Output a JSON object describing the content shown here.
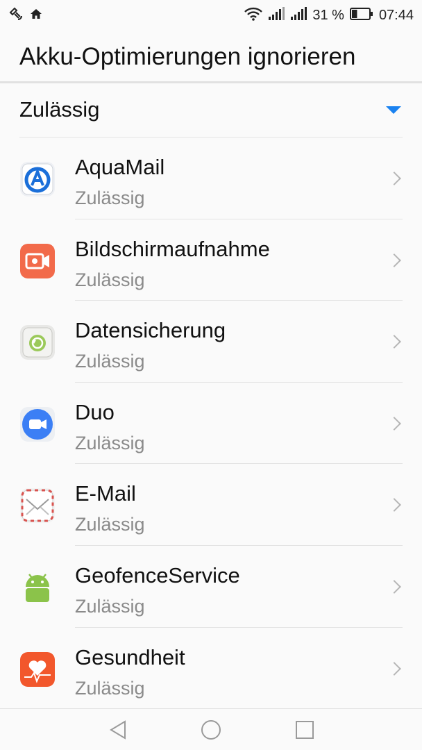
{
  "status_bar": {
    "left_icons": [
      "satellite-icon",
      "home-icon"
    ],
    "right_icons": [
      "wifi-icon",
      "signal-icon",
      "signal-icon"
    ],
    "battery_text": "31 %",
    "battery_level": 0.31,
    "time": "07:44"
  },
  "header": {
    "title": "Akku-Optimierungen ignorieren"
  },
  "filter": {
    "selected": "Zulässig",
    "accent": "#1a82f0"
  },
  "apps": [
    {
      "name": "AquaMail",
      "status": "Zulässig",
      "icon": "aquamail-icon"
    },
    {
      "name": "Bildschirmaufnahme",
      "status": "Zulässig",
      "icon": "screen-recorder-icon"
    },
    {
      "name": "Datensicherung",
      "status": "Zulässig",
      "icon": "backup-icon"
    },
    {
      "name": "Duo",
      "status": "Zulässig",
      "icon": "duo-icon"
    },
    {
      "name": "E-Mail",
      "status": "Zulässig",
      "icon": "email-icon"
    },
    {
      "name": "GeofenceService",
      "status": "Zulässig",
      "icon": "android-icon"
    },
    {
      "name": "Gesundheit",
      "status": "Zulässig",
      "icon": "health-icon"
    }
  ],
  "nav_bar": {
    "buttons": [
      "back-icon",
      "home-icon",
      "recents-icon"
    ]
  }
}
